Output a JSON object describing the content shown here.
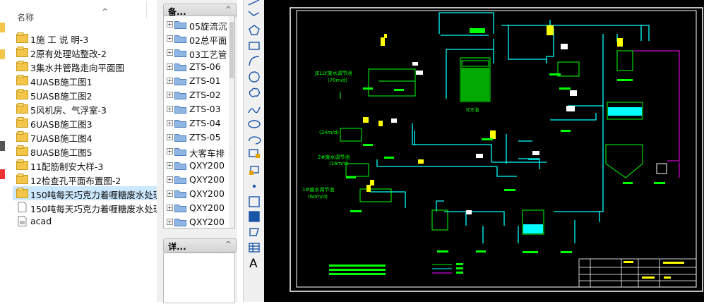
{
  "file_list": {
    "column_header": "名称",
    "sort_chevron": "^",
    "items": [
      {
        "label": "1施 工 说 明-3",
        "type": "dwg"
      },
      {
        "label": "2原有处理站整改-2",
        "type": "dwg"
      },
      {
        "label": "3集水井管路走向平面图",
        "type": "dwg"
      },
      {
        "label": "4UASB施工图1",
        "type": "dwg"
      },
      {
        "label": "5UASB施工图2",
        "type": "dwg"
      },
      {
        "label": "5风机房、气浮室-3",
        "type": "dwg"
      },
      {
        "label": "6UASB施工图3",
        "type": "dwg"
      },
      {
        "label": "7UASB施工图4",
        "type": "dwg"
      },
      {
        "label": "8UASB施工图5",
        "type": "dwg"
      },
      {
        "label": "11配筋制安大样-3",
        "type": "dwg"
      },
      {
        "label": "12检查孔平面布置图-2",
        "type": "dwg"
      },
      {
        "label": "150吨每天巧克力着喱糖废水处理",
        "type": "dwg",
        "selected": true
      },
      {
        "label": "150吨每天巧克力着喱糖废水处理",
        "type": "doc"
      },
      {
        "label": "acad",
        "type": "file"
      }
    ]
  },
  "palette": {
    "header_title": "备...",
    "header_chevron": "^",
    "tree_items": [
      "05旋流沉",
      "02总平面",
      "03工艺管",
      "ZTS-06",
      "ZTS-01",
      "ZTS-02",
      "ZTS-03",
      "ZTS-04",
      "ZTS-05",
      "大客车排",
      "QXY200",
      "QXY200",
      "QXY200",
      "QXY200",
      "QXY200"
    ],
    "detail_title": "详...",
    "detail_chevron": "^"
  },
  "toolbar": {
    "tools": [
      "line-tool",
      "polyline-tool",
      "polygon-tool",
      "rectangle-tool",
      "arc-tool",
      "circle-tool",
      "revision-cloud-tool",
      "spline-tool",
      "ellipse-tool",
      "ellipse-arc-tool",
      "insert-block-tool",
      "make-block-tool",
      "point-tool",
      "hatch-tool",
      "gradient-tool",
      "region-tool",
      "table-tool",
      "multiline-text-tool"
    ],
    "text_tool_glyph": "A"
  },
  "drawing": {
    "labels": [
      "JELLY废水调节池",
      "(70m/d)",
      "(24m/d)",
      "2#废水调节池",
      "(16m/d)",
      "1#废水调节池",
      "(60m/d)",
      "ICE池"
    ]
  }
}
